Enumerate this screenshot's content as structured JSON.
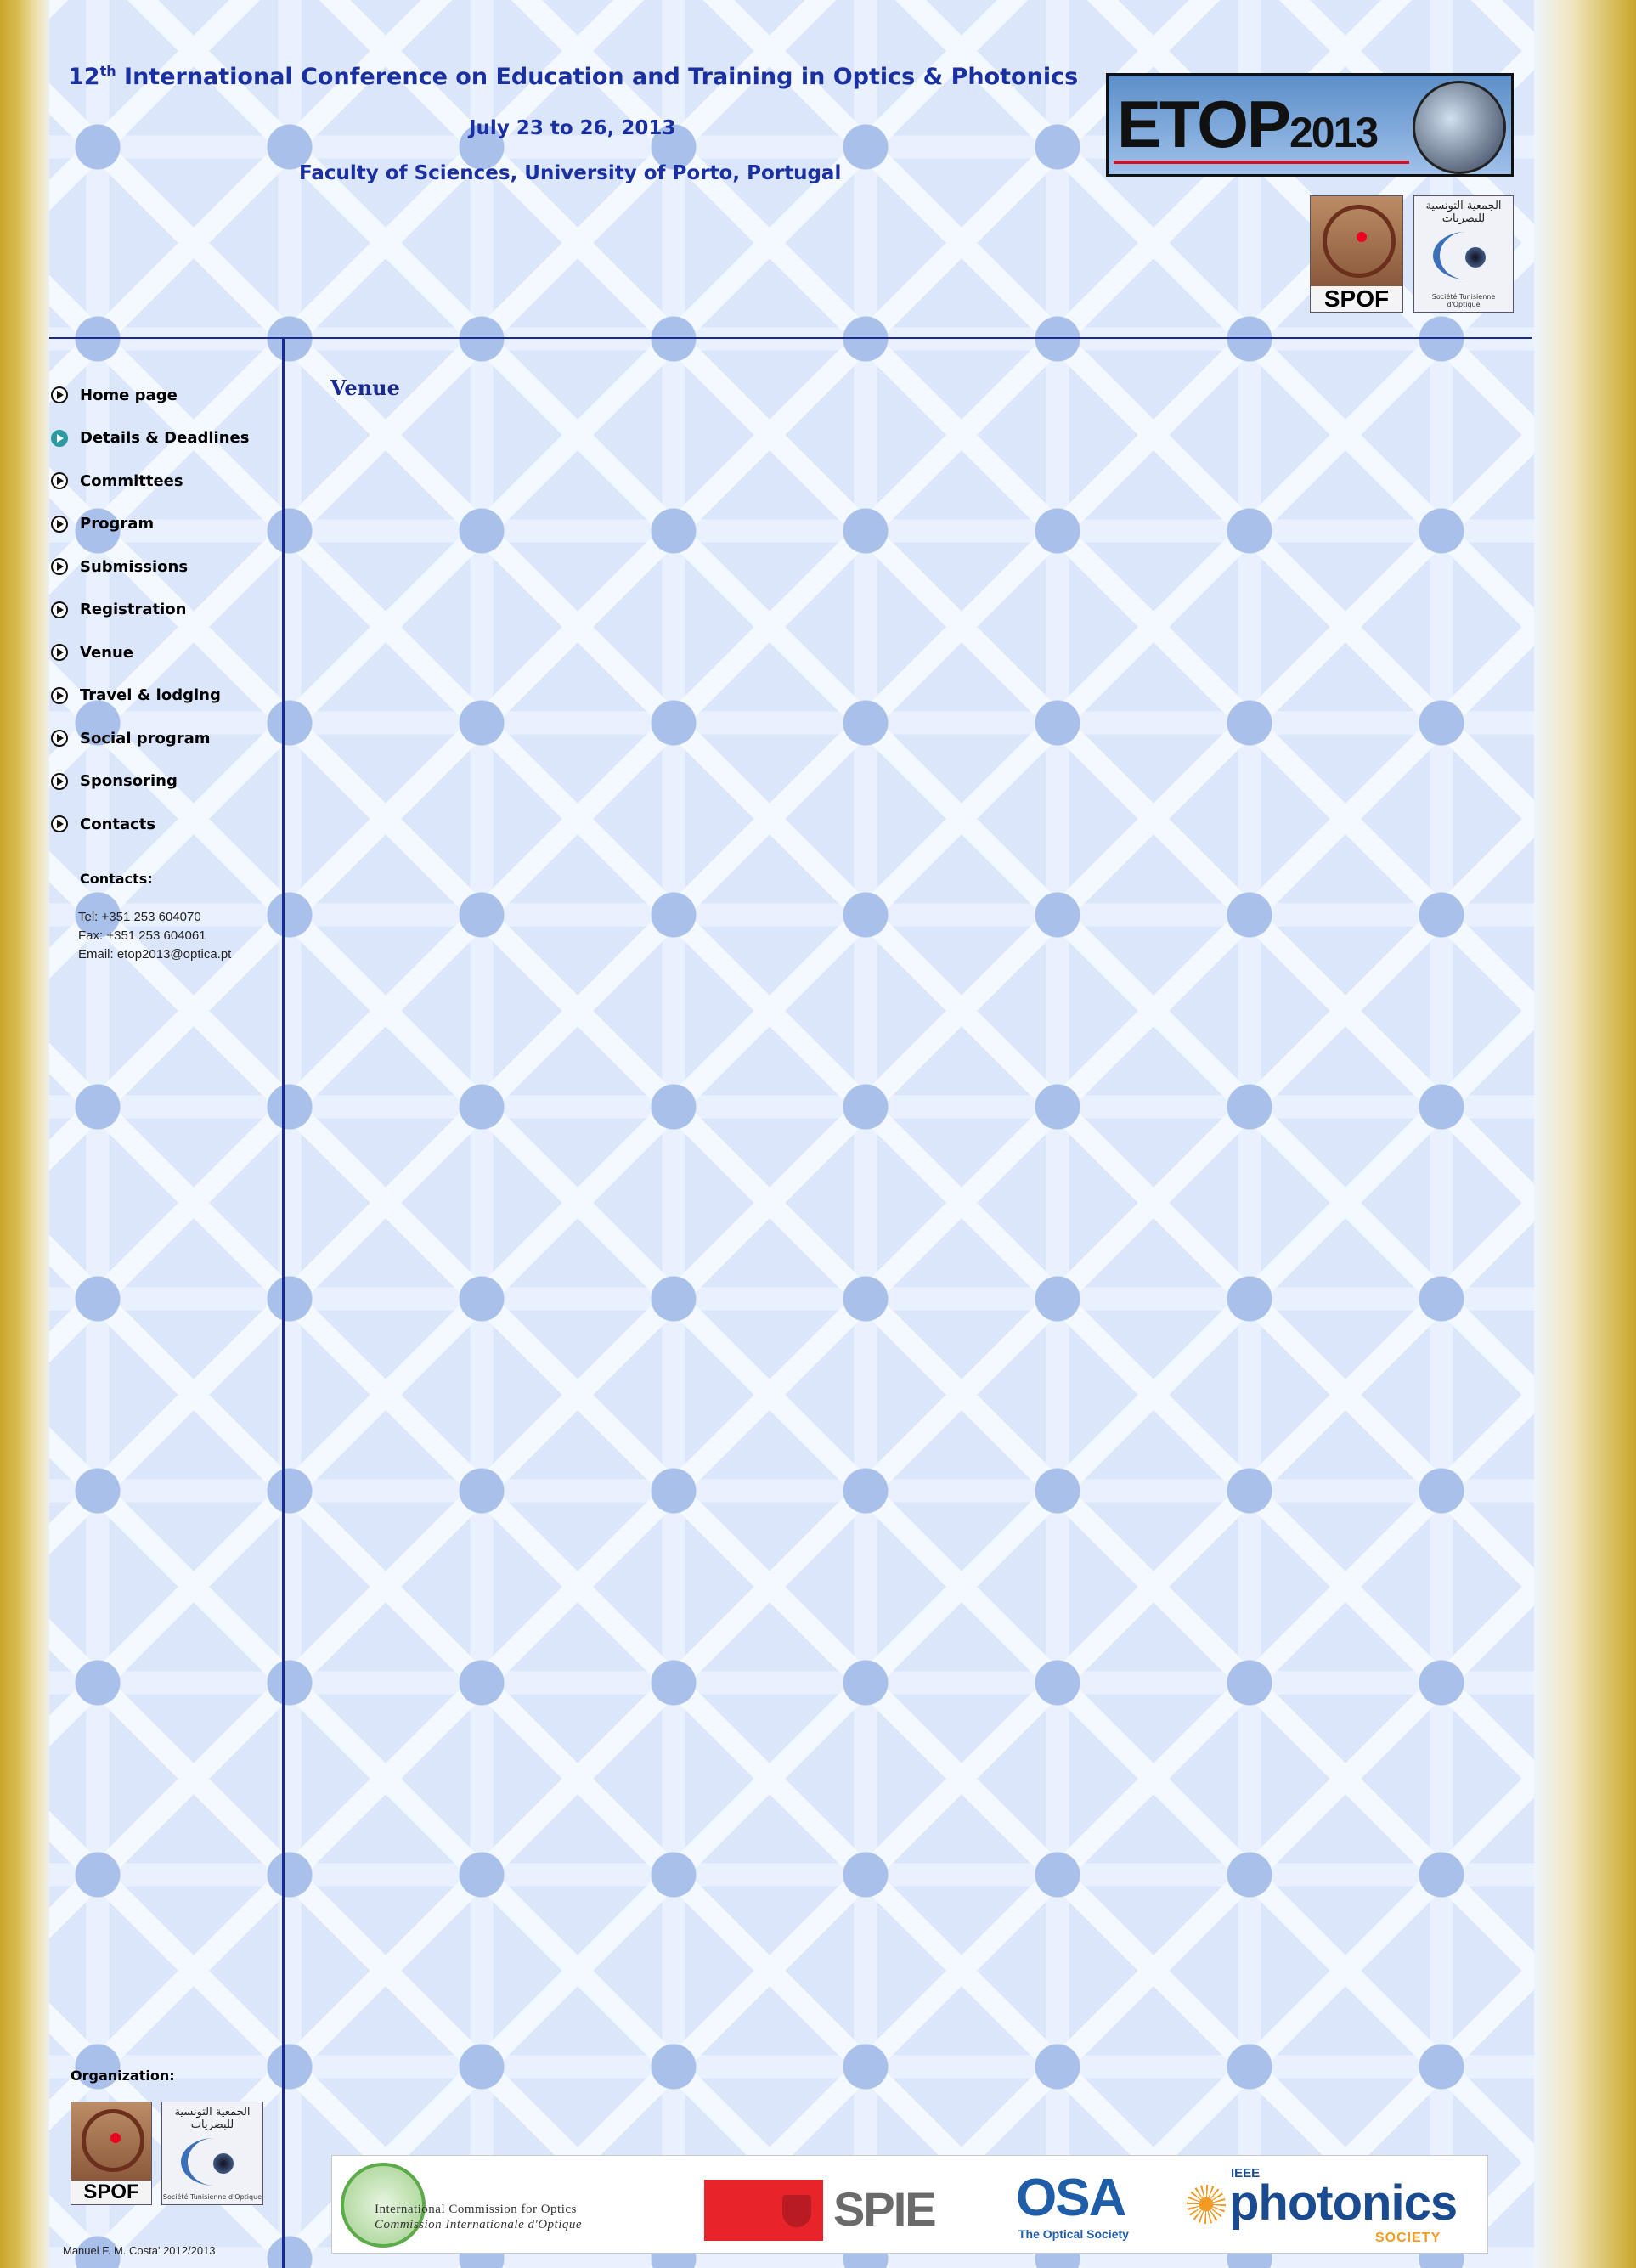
{
  "header": {
    "title_prefix": "12",
    "title_sup": "th",
    "title_main": "International Conference on Education and Training in Optics & Photonics",
    "dates": "July 23 to 26, 2013",
    "venue": "Faculty of Sciences, University of Porto, Portugal",
    "etop_logo_text": "ETOP",
    "etop_logo_year": "2013"
  },
  "logos": {
    "spof": "SPOF",
    "sto_arabic": "الجمعية التونسية للبصريات",
    "sto_mark": "ST",
    "sto_sub": "Société Tunisienne d'Optique"
  },
  "nav": {
    "items": [
      {
        "label": "Home page",
        "active": false
      },
      {
        "label": "Details & Deadlines",
        "active": true
      },
      {
        "label": "Committees",
        "active": false
      },
      {
        "label": "Program",
        "active": false
      },
      {
        "label": "Submissions",
        "active": false
      },
      {
        "label": "Registration",
        "active": false
      },
      {
        "label": "Venue",
        "active": false
      },
      {
        "label": "Travel & lodging",
        "active": false
      },
      {
        "label": "Social program",
        "active": false
      },
      {
        "label": "Sponsoring",
        "active": false
      },
      {
        "label": "Contacts",
        "active": false
      }
    ]
  },
  "contacts": {
    "heading": "Contacts:",
    "tel": "Tel: +351 253 604070",
    "fax": "Fax: +351 253 604061",
    "email": "Email: etop2013@optica.pt"
  },
  "content": {
    "title": "Venue"
  },
  "organization": {
    "label": "Organization:"
  },
  "sponsors": {
    "ico_line1": "International Commission for Optics",
    "ico_line2": "Commission Internationale d'Optique",
    "spie": "SPIE",
    "osa": "OSA",
    "osa_sub": "The Optical Society",
    "ieee_small": "IEEE",
    "ieee_photonics": "photonics",
    "ieee_society": "SOCIETY"
  },
  "footer": {
    "credit": "Manuel F. M. Costa' 2012/2013"
  },
  "colors": {
    "heading_blue": "#1a2fa0",
    "rule_blue": "#1a2a90",
    "active_bullet": "#2a9aa0",
    "side_gold": "#c9a52b"
  }
}
